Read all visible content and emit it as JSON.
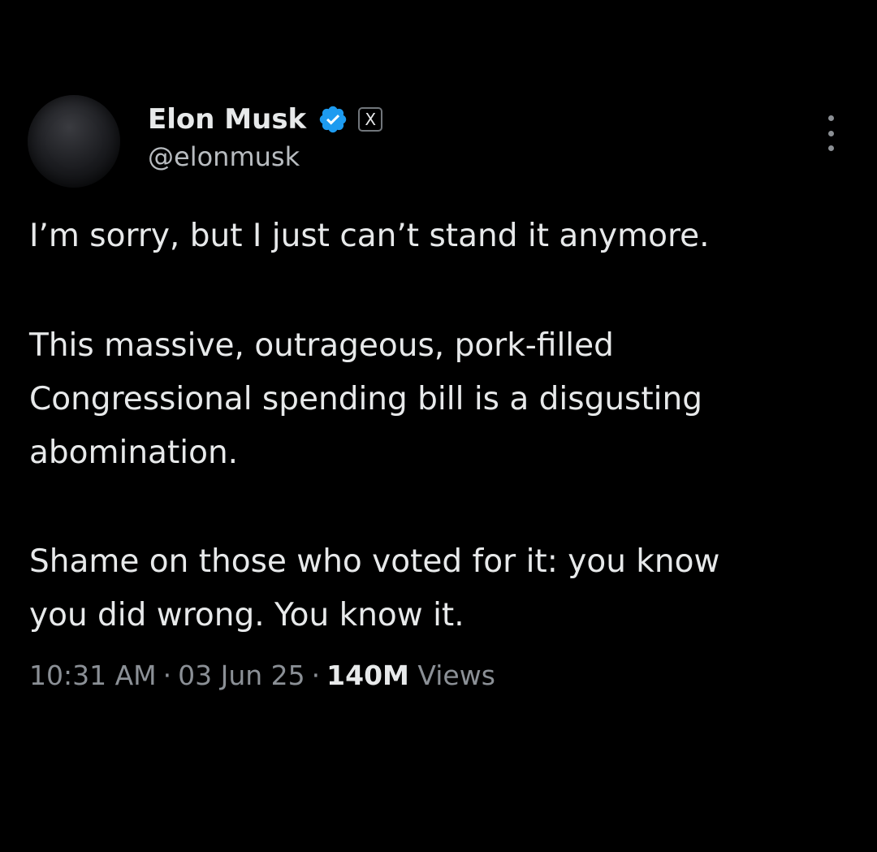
{
  "author": {
    "display_name": "Elon Musk",
    "handle": "@elonmusk",
    "verified_badge": "blue-check-badge",
    "affiliation_badge": "X"
  },
  "tweet": {
    "paragraph_1": "I’m sorry, but I just can’t stand it anymore.",
    "paragraph_2_lines": [
      "This massive, outrageous, pork-filled",
      "Congressional spending bill is a disgusting",
      "abomination."
    ],
    "paragraph_3_lines": [
      "Shame on those who voted for it: you know",
      "you did wrong. You know it."
    ]
  },
  "meta": {
    "time": "10:31 AM",
    "date": "03 Jun 25",
    "separator": "·",
    "views_count": "140M",
    "views_label": "Views"
  },
  "colors": {
    "background": "#000000",
    "text_primary": "#e7e9ea",
    "text_secondary": "#8b9096",
    "verified_blue": "#1d9bf0"
  }
}
